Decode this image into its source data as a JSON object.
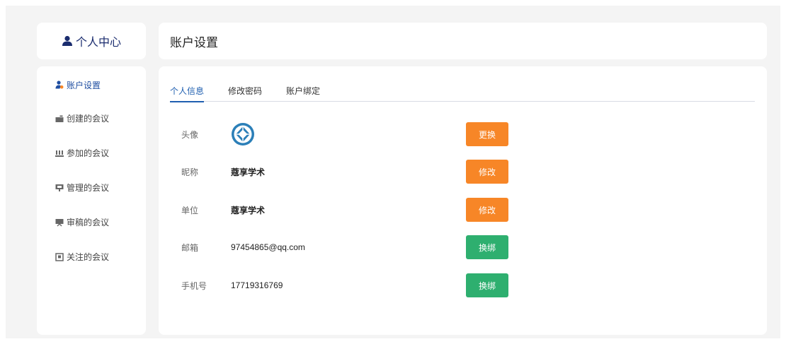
{
  "sidebar": {
    "title": "个人中心",
    "items": [
      {
        "label": "账户设置",
        "icon": "user-settings-icon",
        "active": true
      },
      {
        "label": "创建的会议",
        "icon": "create-meeting-icon",
        "active": false
      },
      {
        "label": "参加的会议",
        "icon": "join-meeting-icon",
        "active": false
      },
      {
        "label": "管理的会议",
        "icon": "manage-meeting-icon",
        "active": false
      },
      {
        "label": "审稿的会议",
        "icon": "review-meeting-icon",
        "active": false
      },
      {
        "label": "关注的会议",
        "icon": "follow-meeting-icon",
        "active": false
      }
    ]
  },
  "header": {
    "title": "账户设置"
  },
  "tabs": [
    {
      "label": "个人信息",
      "active": true
    },
    {
      "label": "修改密码",
      "active": false
    },
    {
      "label": "账户绑定",
      "active": false
    }
  ],
  "profile": {
    "avatar": {
      "label": "头像",
      "button": "更换"
    },
    "nickname": {
      "label": "昵称",
      "value": "蔻享学术",
      "button": "修改"
    },
    "unit": {
      "label": "单位",
      "value": "蔻享学术",
      "button": "修改"
    },
    "email": {
      "label": "邮箱",
      "value": "97454865@qq.com",
      "button": "换绑"
    },
    "phone": {
      "label": "手机号",
      "value": "17719316769",
      "button": "换绑"
    }
  },
  "colors": {
    "accent": "#1f5fb0",
    "primary_dark": "#1a2c6e",
    "orange_button": "#f78627",
    "green_button": "#2eaf6f",
    "background": "#f4f4f4"
  }
}
